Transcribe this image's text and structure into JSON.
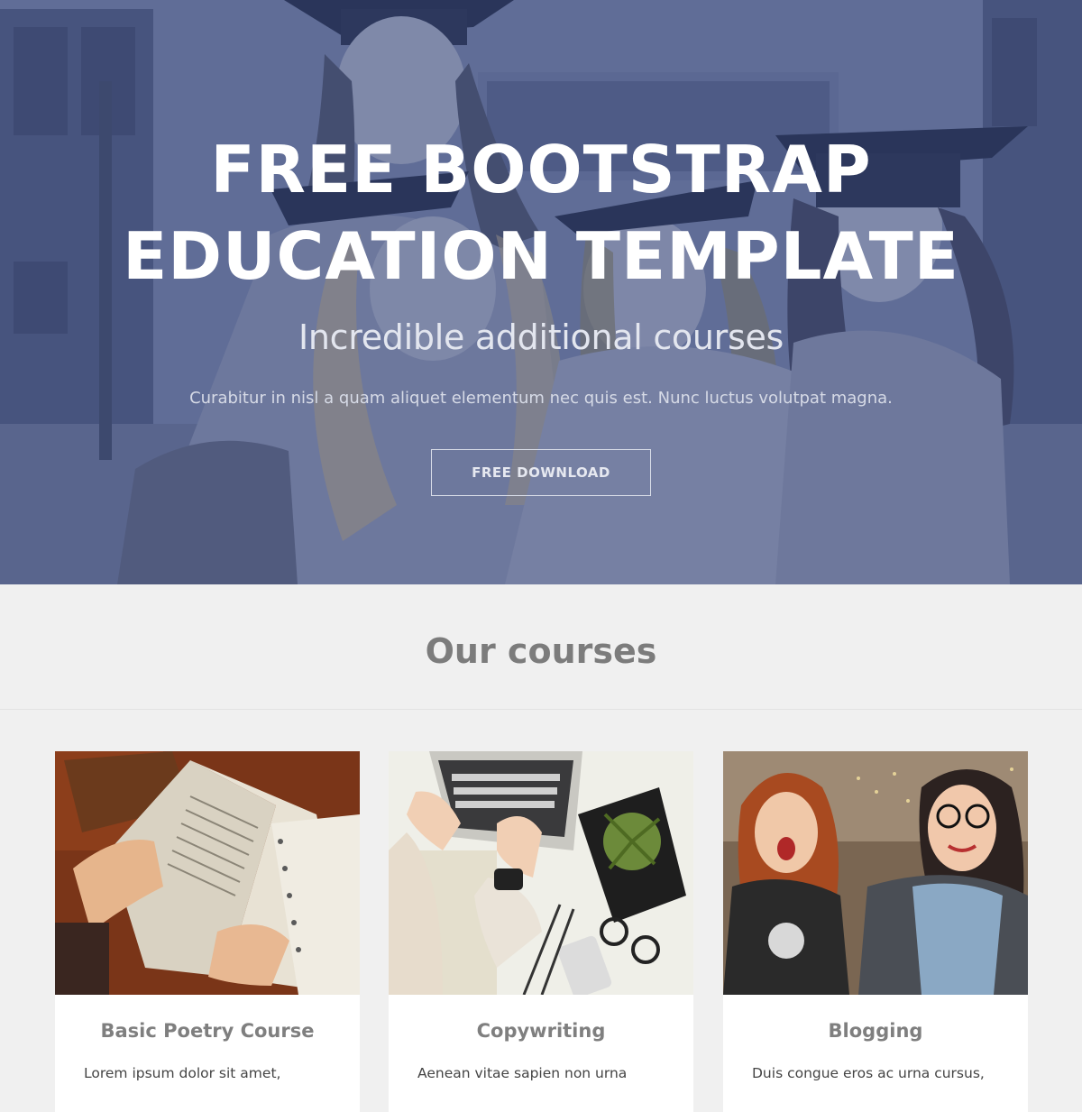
{
  "hero": {
    "title_line1": "FREE BOOTSTRAP",
    "title_line2": "EDUCATION TEMPLATE",
    "subtitle": "Incredible additional courses",
    "text": "Curabitur in nisl a quam aliquet elementum nec quis est. Nunc luctus volutpat magna.",
    "button_label": "FREE DOWNLOAD",
    "overlay_color": "#5a6790"
  },
  "courses": {
    "title": "Our courses",
    "items": [
      {
        "title": "Basic Poetry Course",
        "excerpt": "Lorem ipsum dolor sit amet,",
        "image": "open-book-photo"
      },
      {
        "title": "Copywriting",
        "excerpt": "Aenean vitae sapien non urna",
        "image": "laptop-desk-photo"
      },
      {
        "title": "Blogging",
        "excerpt": "Duis congue eros ac urna cursus,",
        "image": "two-girls-photo"
      }
    ]
  },
  "colors": {
    "page_background": "#f0f0f0",
    "card_background": "#ffffff",
    "heading_gray": "#7c7c7c"
  }
}
